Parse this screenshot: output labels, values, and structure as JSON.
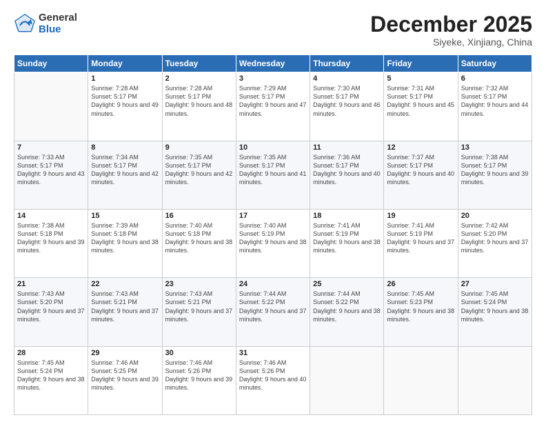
{
  "logo": {
    "general": "General",
    "blue": "Blue"
  },
  "header": {
    "month": "December 2025",
    "location": "Siyeke, Xinjiang, China"
  },
  "weekdays": [
    "Sunday",
    "Monday",
    "Tuesday",
    "Wednesday",
    "Thursday",
    "Friday",
    "Saturday"
  ],
  "weeks": [
    [
      {
        "day": "",
        "sunrise": "",
        "sunset": "",
        "daylight": ""
      },
      {
        "day": "1",
        "sunrise": "Sunrise: 7:28 AM",
        "sunset": "Sunset: 5:17 PM",
        "daylight": "Daylight: 9 hours and 49 minutes."
      },
      {
        "day": "2",
        "sunrise": "Sunrise: 7:28 AM",
        "sunset": "Sunset: 5:17 PM",
        "daylight": "Daylight: 9 hours and 48 minutes."
      },
      {
        "day": "3",
        "sunrise": "Sunrise: 7:29 AM",
        "sunset": "Sunset: 5:17 PM",
        "daylight": "Daylight: 9 hours and 47 minutes."
      },
      {
        "day": "4",
        "sunrise": "Sunrise: 7:30 AM",
        "sunset": "Sunset: 5:17 PM",
        "daylight": "Daylight: 9 hours and 46 minutes."
      },
      {
        "day": "5",
        "sunrise": "Sunrise: 7:31 AM",
        "sunset": "Sunset: 5:17 PM",
        "daylight": "Daylight: 9 hours and 45 minutes."
      },
      {
        "day": "6",
        "sunrise": "Sunrise: 7:32 AM",
        "sunset": "Sunset: 5:17 PM",
        "daylight": "Daylight: 9 hours and 44 minutes."
      }
    ],
    [
      {
        "day": "7",
        "sunrise": "Sunrise: 7:33 AM",
        "sunset": "Sunset: 5:17 PM",
        "daylight": "Daylight: 9 hours and 43 minutes."
      },
      {
        "day": "8",
        "sunrise": "Sunrise: 7:34 AM",
        "sunset": "Sunset: 5:17 PM",
        "daylight": "Daylight: 9 hours and 42 minutes."
      },
      {
        "day": "9",
        "sunrise": "Sunrise: 7:35 AM",
        "sunset": "Sunset: 5:17 PM",
        "daylight": "Daylight: 9 hours and 42 minutes."
      },
      {
        "day": "10",
        "sunrise": "Sunrise: 7:35 AM",
        "sunset": "Sunset: 5:17 PM",
        "daylight": "Daylight: 9 hours and 41 minutes."
      },
      {
        "day": "11",
        "sunrise": "Sunrise: 7:36 AM",
        "sunset": "Sunset: 5:17 PM",
        "daylight": "Daylight: 9 hours and 40 minutes."
      },
      {
        "day": "12",
        "sunrise": "Sunrise: 7:37 AM",
        "sunset": "Sunset: 5:17 PM",
        "daylight": "Daylight: 9 hours and 40 minutes."
      },
      {
        "day": "13",
        "sunrise": "Sunrise: 7:38 AM",
        "sunset": "Sunset: 5:17 PM",
        "daylight": "Daylight: 9 hours and 39 minutes."
      }
    ],
    [
      {
        "day": "14",
        "sunrise": "Sunrise: 7:38 AM",
        "sunset": "Sunset: 5:18 PM",
        "daylight": "Daylight: 9 hours and 39 minutes."
      },
      {
        "day": "15",
        "sunrise": "Sunrise: 7:39 AM",
        "sunset": "Sunset: 5:18 PM",
        "daylight": "Daylight: 9 hours and 38 minutes."
      },
      {
        "day": "16",
        "sunrise": "Sunrise: 7:40 AM",
        "sunset": "Sunset: 5:18 PM",
        "daylight": "Daylight: 9 hours and 38 minutes."
      },
      {
        "day": "17",
        "sunrise": "Sunrise: 7:40 AM",
        "sunset": "Sunset: 5:19 PM",
        "daylight": "Daylight: 9 hours and 38 minutes."
      },
      {
        "day": "18",
        "sunrise": "Sunrise: 7:41 AM",
        "sunset": "Sunset: 5:19 PM",
        "daylight": "Daylight: 9 hours and 38 minutes."
      },
      {
        "day": "19",
        "sunrise": "Sunrise: 7:41 AM",
        "sunset": "Sunset: 5:19 PM",
        "daylight": "Daylight: 9 hours and 37 minutes."
      },
      {
        "day": "20",
        "sunrise": "Sunrise: 7:42 AM",
        "sunset": "Sunset: 5:20 PM",
        "daylight": "Daylight: 9 hours and 37 minutes."
      }
    ],
    [
      {
        "day": "21",
        "sunrise": "Sunrise: 7:43 AM",
        "sunset": "Sunset: 5:20 PM",
        "daylight": "Daylight: 9 hours and 37 minutes."
      },
      {
        "day": "22",
        "sunrise": "Sunrise: 7:43 AM",
        "sunset": "Sunset: 5:21 PM",
        "daylight": "Daylight: 9 hours and 37 minutes."
      },
      {
        "day": "23",
        "sunrise": "Sunrise: 7:43 AM",
        "sunset": "Sunset: 5:21 PM",
        "daylight": "Daylight: 9 hours and 37 minutes."
      },
      {
        "day": "24",
        "sunrise": "Sunrise: 7:44 AM",
        "sunset": "Sunset: 5:22 PM",
        "daylight": "Daylight: 9 hours and 37 minutes."
      },
      {
        "day": "25",
        "sunrise": "Sunrise: 7:44 AM",
        "sunset": "Sunset: 5:22 PM",
        "daylight": "Daylight: 9 hours and 38 minutes."
      },
      {
        "day": "26",
        "sunrise": "Sunrise: 7:45 AM",
        "sunset": "Sunset: 5:23 PM",
        "daylight": "Daylight: 9 hours and 38 minutes."
      },
      {
        "day": "27",
        "sunrise": "Sunrise: 7:45 AM",
        "sunset": "Sunset: 5:24 PM",
        "daylight": "Daylight: 9 hours and 38 minutes."
      }
    ],
    [
      {
        "day": "28",
        "sunrise": "Sunrise: 7:45 AM",
        "sunset": "Sunset: 5:24 PM",
        "daylight": "Daylight: 9 hours and 38 minutes."
      },
      {
        "day": "29",
        "sunrise": "Sunrise: 7:46 AM",
        "sunset": "Sunset: 5:25 PM",
        "daylight": "Daylight: 9 hours and 39 minutes."
      },
      {
        "day": "30",
        "sunrise": "Sunrise: 7:46 AM",
        "sunset": "Sunset: 5:26 PM",
        "daylight": "Daylight: 9 hours and 39 minutes."
      },
      {
        "day": "31",
        "sunrise": "Sunrise: 7:46 AM",
        "sunset": "Sunset: 5:26 PM",
        "daylight": "Daylight: 9 hours and 40 minutes."
      },
      {
        "day": "",
        "sunrise": "",
        "sunset": "",
        "daylight": ""
      },
      {
        "day": "",
        "sunrise": "",
        "sunset": "",
        "daylight": ""
      },
      {
        "day": "",
        "sunrise": "",
        "sunset": "",
        "daylight": ""
      }
    ]
  ]
}
